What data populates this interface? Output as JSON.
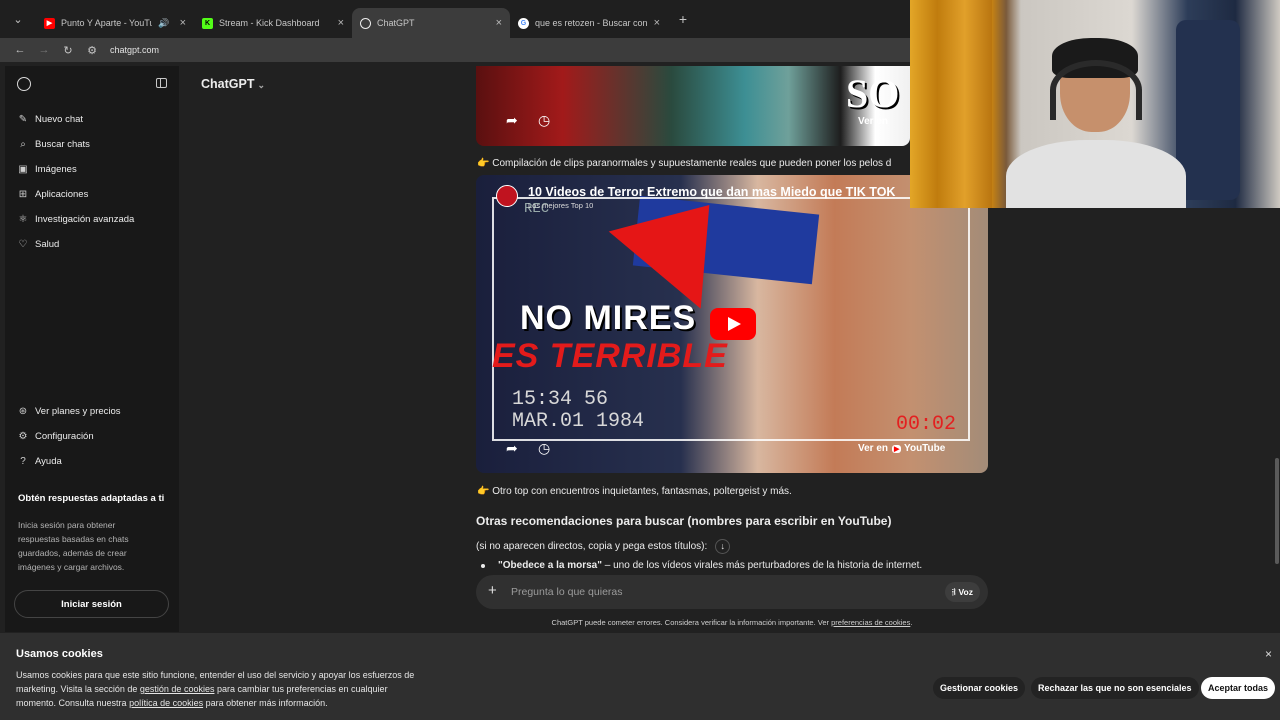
{
  "browser": {
    "tabs": [
      {
        "title": "Punto Y Aparte - YouTube",
        "favicon_color": "#ff0000",
        "favicon_glyph": "▶",
        "active": false,
        "audio": true
      },
      {
        "title": "Stream - Kick Dashboard",
        "favicon_color": "#53fc18",
        "favicon_glyph": "K",
        "active": false,
        "audio": false
      },
      {
        "title": "ChatGPT",
        "favicon_color": "#ececec",
        "favicon_glyph": "◎",
        "active": true,
        "audio": false
      },
      {
        "title": "que es retozen - Buscar con Go",
        "favicon_color": "#4285f4",
        "favicon_glyph": "G",
        "active": false,
        "audio": false
      }
    ],
    "new_tab": "+",
    "url": "chatgpt.com"
  },
  "sidebar": {
    "items": [
      {
        "label": "Nuevo chat",
        "icon": "edit-icon"
      },
      {
        "label": "Buscar chats",
        "icon": "search-icon"
      },
      {
        "label": "Imágenes",
        "icon": "image-icon"
      },
      {
        "label": "Aplicaciones",
        "icon": "apps-icon"
      },
      {
        "label": "Investigación avanzada",
        "icon": "research-icon"
      },
      {
        "label": "Salud",
        "icon": "heart-icon"
      }
    ],
    "bottom_items": [
      {
        "label": "Ver planes y precios",
        "icon": "plans-icon"
      },
      {
        "label": "Configuración",
        "icon": "gear-icon"
      },
      {
        "label": "Ayuda",
        "icon": "help-icon"
      }
    ],
    "promo_title": "Obtén respuestas adaptadas a ti",
    "promo_text": "Inicia sesión para obtener respuestas basadas en chats guardados, además de crear imágenes y cargar archivos.",
    "login_label": "Iniciar sesión"
  },
  "header": {
    "model": "ChatGPT"
  },
  "chat": {
    "video1": {
      "overlay_text": "SO",
      "watch_on": "Ver en"
    },
    "caption1": "👉 Compilación de clips paranormales y supuestamente reales que pueden poner los pelos d",
    "video2": {
      "title": "10 Videos de Terror Extremo que dan mas Miedo que TIK TOK",
      "channel": "Los mejores Top 10",
      "rec": "REC",
      "main_text": "NO MIRES",
      "sub_text": "ES TERRIBLE",
      "timestamp": "15:34 56\nMAR.01 1984",
      "counter": "00:02",
      "watch_on": "Ver en",
      "youtube_label": "YouTube"
    },
    "caption2": "👉 Otro top con encuentros inquietantes, fantasmas, poltergeist y más.",
    "section_title": "Otras recomendaciones para buscar (nombres para escribir en YouTube)",
    "note": "(si no aparecen directos, copia y pega estos títulos):",
    "list": [
      {
        "bold": "\"Obedece a la morsa\"",
        "text": " – uno de los vídeos virales más perturbadores de la historia de internet."
      }
    ]
  },
  "composer": {
    "placeholder": "Pregunta lo que quieras",
    "voice_label": "Voz"
  },
  "disclaimer": {
    "text": "ChatGPT puede cometer errores. Considera verificar la información importante. Ver ",
    "link": "preferencias de cookies",
    "end": "."
  },
  "cookies": {
    "title": "Usamos cookies",
    "body_1": "Usamos cookies para que este sitio funcione, entender el uso del servicio y apoyar los esfuerzos de marketing. Visita la sección de ",
    "link_1": "gestión de cookies",
    "body_2": " para cambiar tus preferencias en cualquier momento. Consulta nuestra ",
    "link_2": "política de cookies",
    "body_3": " para obtener más información.",
    "manage": "Gestionar cookies",
    "reject": "Rechazar las que no son esenciales",
    "accept": "Aceptar todas",
    "close": "×"
  }
}
